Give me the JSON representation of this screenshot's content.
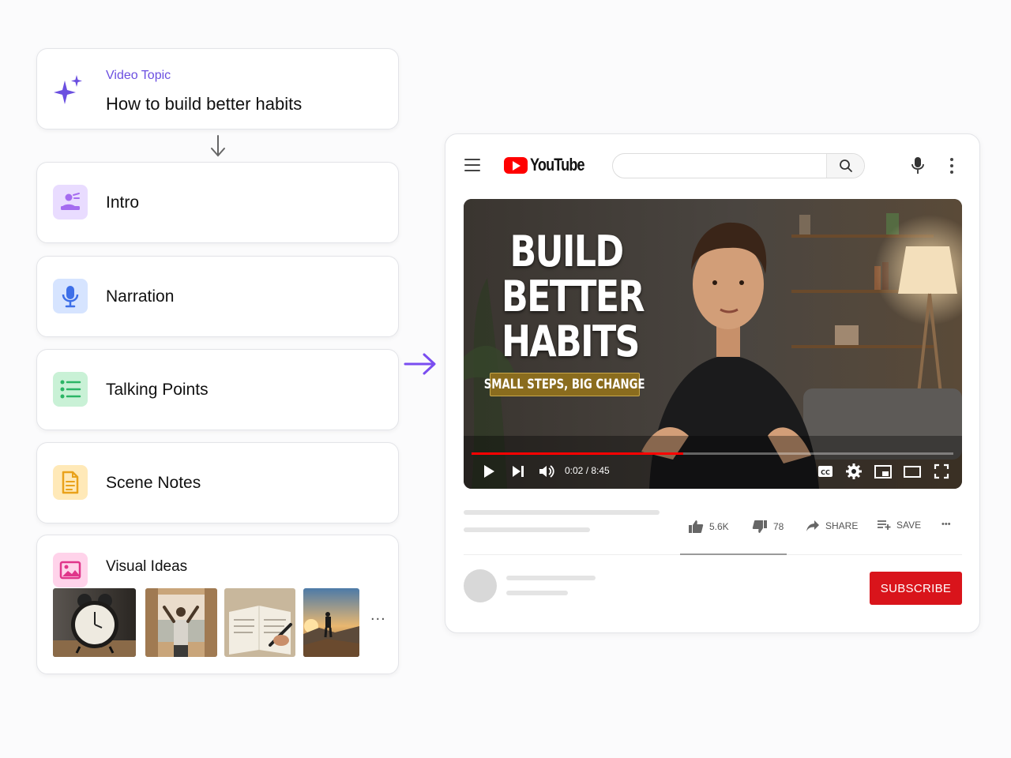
{
  "topic": {
    "eyebrow": "Video Topic",
    "title": "How to build better habits"
  },
  "sections": [
    {
      "label": "Intro",
      "icon": "presenter-icon",
      "color": "#a56cf0"
    },
    {
      "label": "Narration",
      "icon": "microphone-icon",
      "color": "#3d6fe8"
    },
    {
      "label": "Talking Points",
      "icon": "list-icon",
      "color": "#2bb565"
    },
    {
      "label": "Scene Notes",
      "icon": "document-icon",
      "color": "#e9a21b"
    }
  ],
  "visual_ideas": {
    "label": "Visual Ideas",
    "icon": "image-icon",
    "thumbnails": [
      "alarm-clock",
      "person-at-window",
      "journal-writing",
      "hiker-sunset"
    ],
    "more": "..."
  },
  "youtube": {
    "logo_text": "YouTube",
    "search_placeholder": "",
    "video": {
      "headline": [
        "BUILD",
        "BETTER",
        "HABITS"
      ],
      "tagline": "SMALL STEPS, BIG CHANGE",
      "time": "0:02 / 8:45",
      "progress": 0.44
    },
    "actions": {
      "likes": "5.6K",
      "dislikes": "78",
      "share": "SHARE",
      "save": "SAVE",
      "more": "•••"
    },
    "subscribe": "SUBSCRIBE"
  },
  "colors": {
    "accent": "#6b4fe0",
    "youtube_red": "#ff0000",
    "subscribe_red": "#d9141b"
  }
}
